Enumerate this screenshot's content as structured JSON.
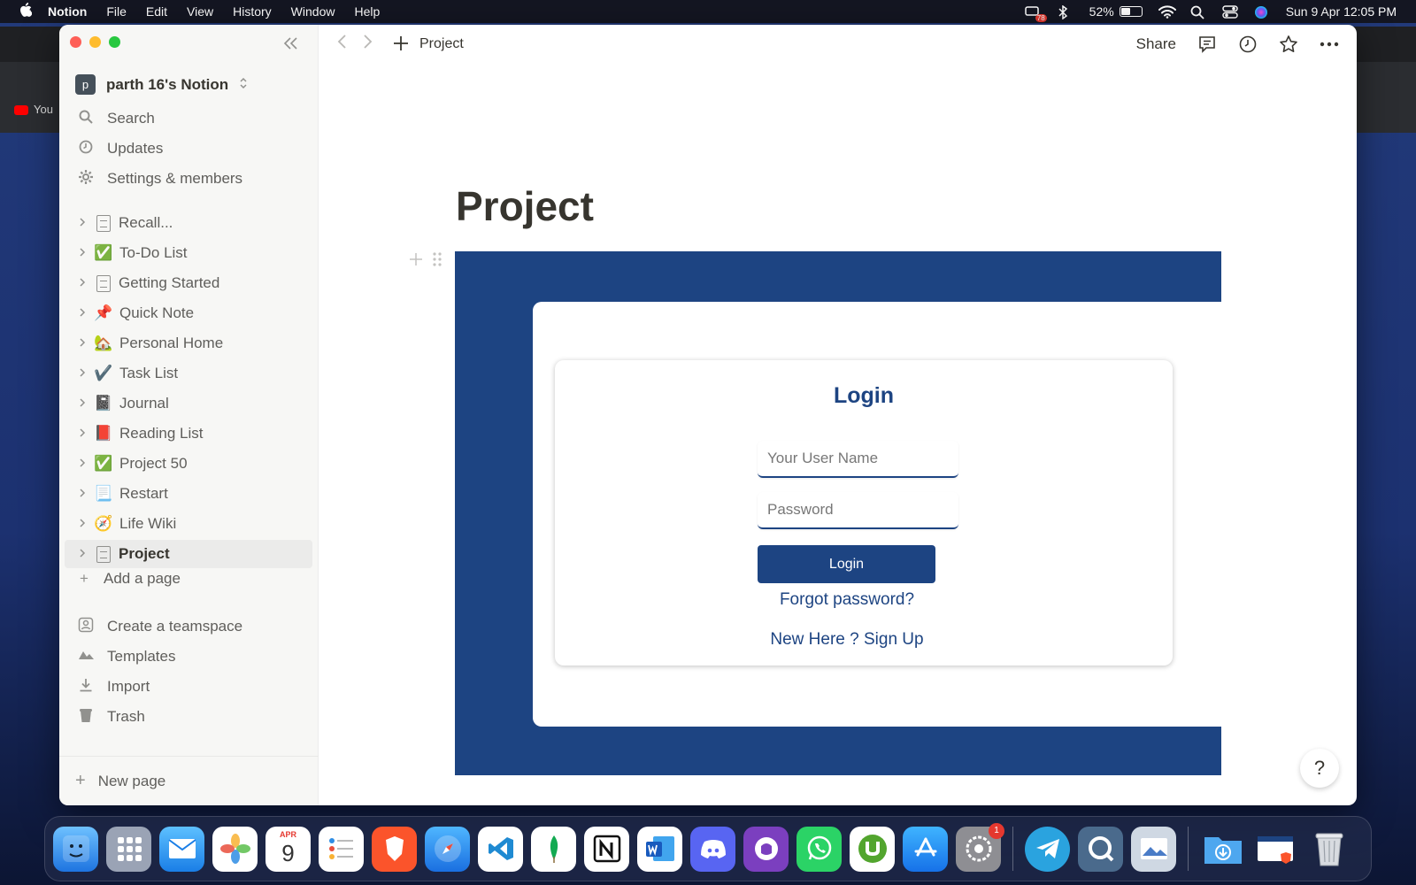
{
  "menubar": {
    "apple": "",
    "app_name": "Notion",
    "items": [
      "File",
      "Edit",
      "View",
      "History",
      "Window",
      "Help"
    ],
    "battery": "52%",
    "battery_level": 0.52,
    "datetime": "Sun 9 Apr  12:05 PM",
    "notification_count": "78"
  },
  "background_browser": {
    "tab_text": "You"
  },
  "sidebar": {
    "workspace_initial": "p",
    "workspace_name": "parth 16's Notion",
    "quick_links": [
      {
        "label": "Search",
        "icon": "search-icon"
      },
      {
        "label": "Updates",
        "icon": "clock-icon"
      },
      {
        "label": "Settings & members",
        "icon": "gear-icon"
      }
    ],
    "pages": [
      {
        "label": "Recall...",
        "icon": "doc"
      },
      {
        "label": "To-Do List",
        "icon": "✅"
      },
      {
        "label": "Getting Started",
        "icon": "doc"
      },
      {
        "label": "Quick Note",
        "icon": "📌"
      },
      {
        "label": "Personal Home",
        "icon": "🏡"
      },
      {
        "label": "Task List",
        "icon": "✔️"
      },
      {
        "label": "Journal",
        "icon": "📓"
      },
      {
        "label": "Reading List",
        "icon": "📕"
      },
      {
        "label": "Project 50",
        "icon": "✅"
      },
      {
        "label": "Restart",
        "icon": "📃"
      },
      {
        "label": "Life Wiki",
        "icon": "🧭"
      },
      {
        "label": "Project",
        "icon": "doc",
        "selected": true
      }
    ],
    "add_page": "Add a page",
    "tools": [
      {
        "label": "Create a teamspace",
        "icon": "teamspace-icon"
      },
      {
        "label": "Templates",
        "icon": "templates-icon"
      },
      {
        "label": "Import",
        "icon": "import-icon"
      },
      {
        "label": "Trash",
        "icon": "trash-icon"
      }
    ],
    "new_page": "New page"
  },
  "topbar": {
    "breadcrumb": "Project",
    "share": "Share"
  },
  "page": {
    "title": "Project",
    "embed": {
      "login_title": "Login",
      "username_placeholder": "Your User Name",
      "password_placeholder": "Password",
      "login_button": "Login",
      "forgot_password": "Forgot password?",
      "signup": "New Here ? Sign Up",
      "brand_color": "#1d4482"
    }
  },
  "help": "?",
  "dock": {
    "calendar_month": "APR",
    "calendar_day": "9",
    "settings_badge": "1"
  }
}
